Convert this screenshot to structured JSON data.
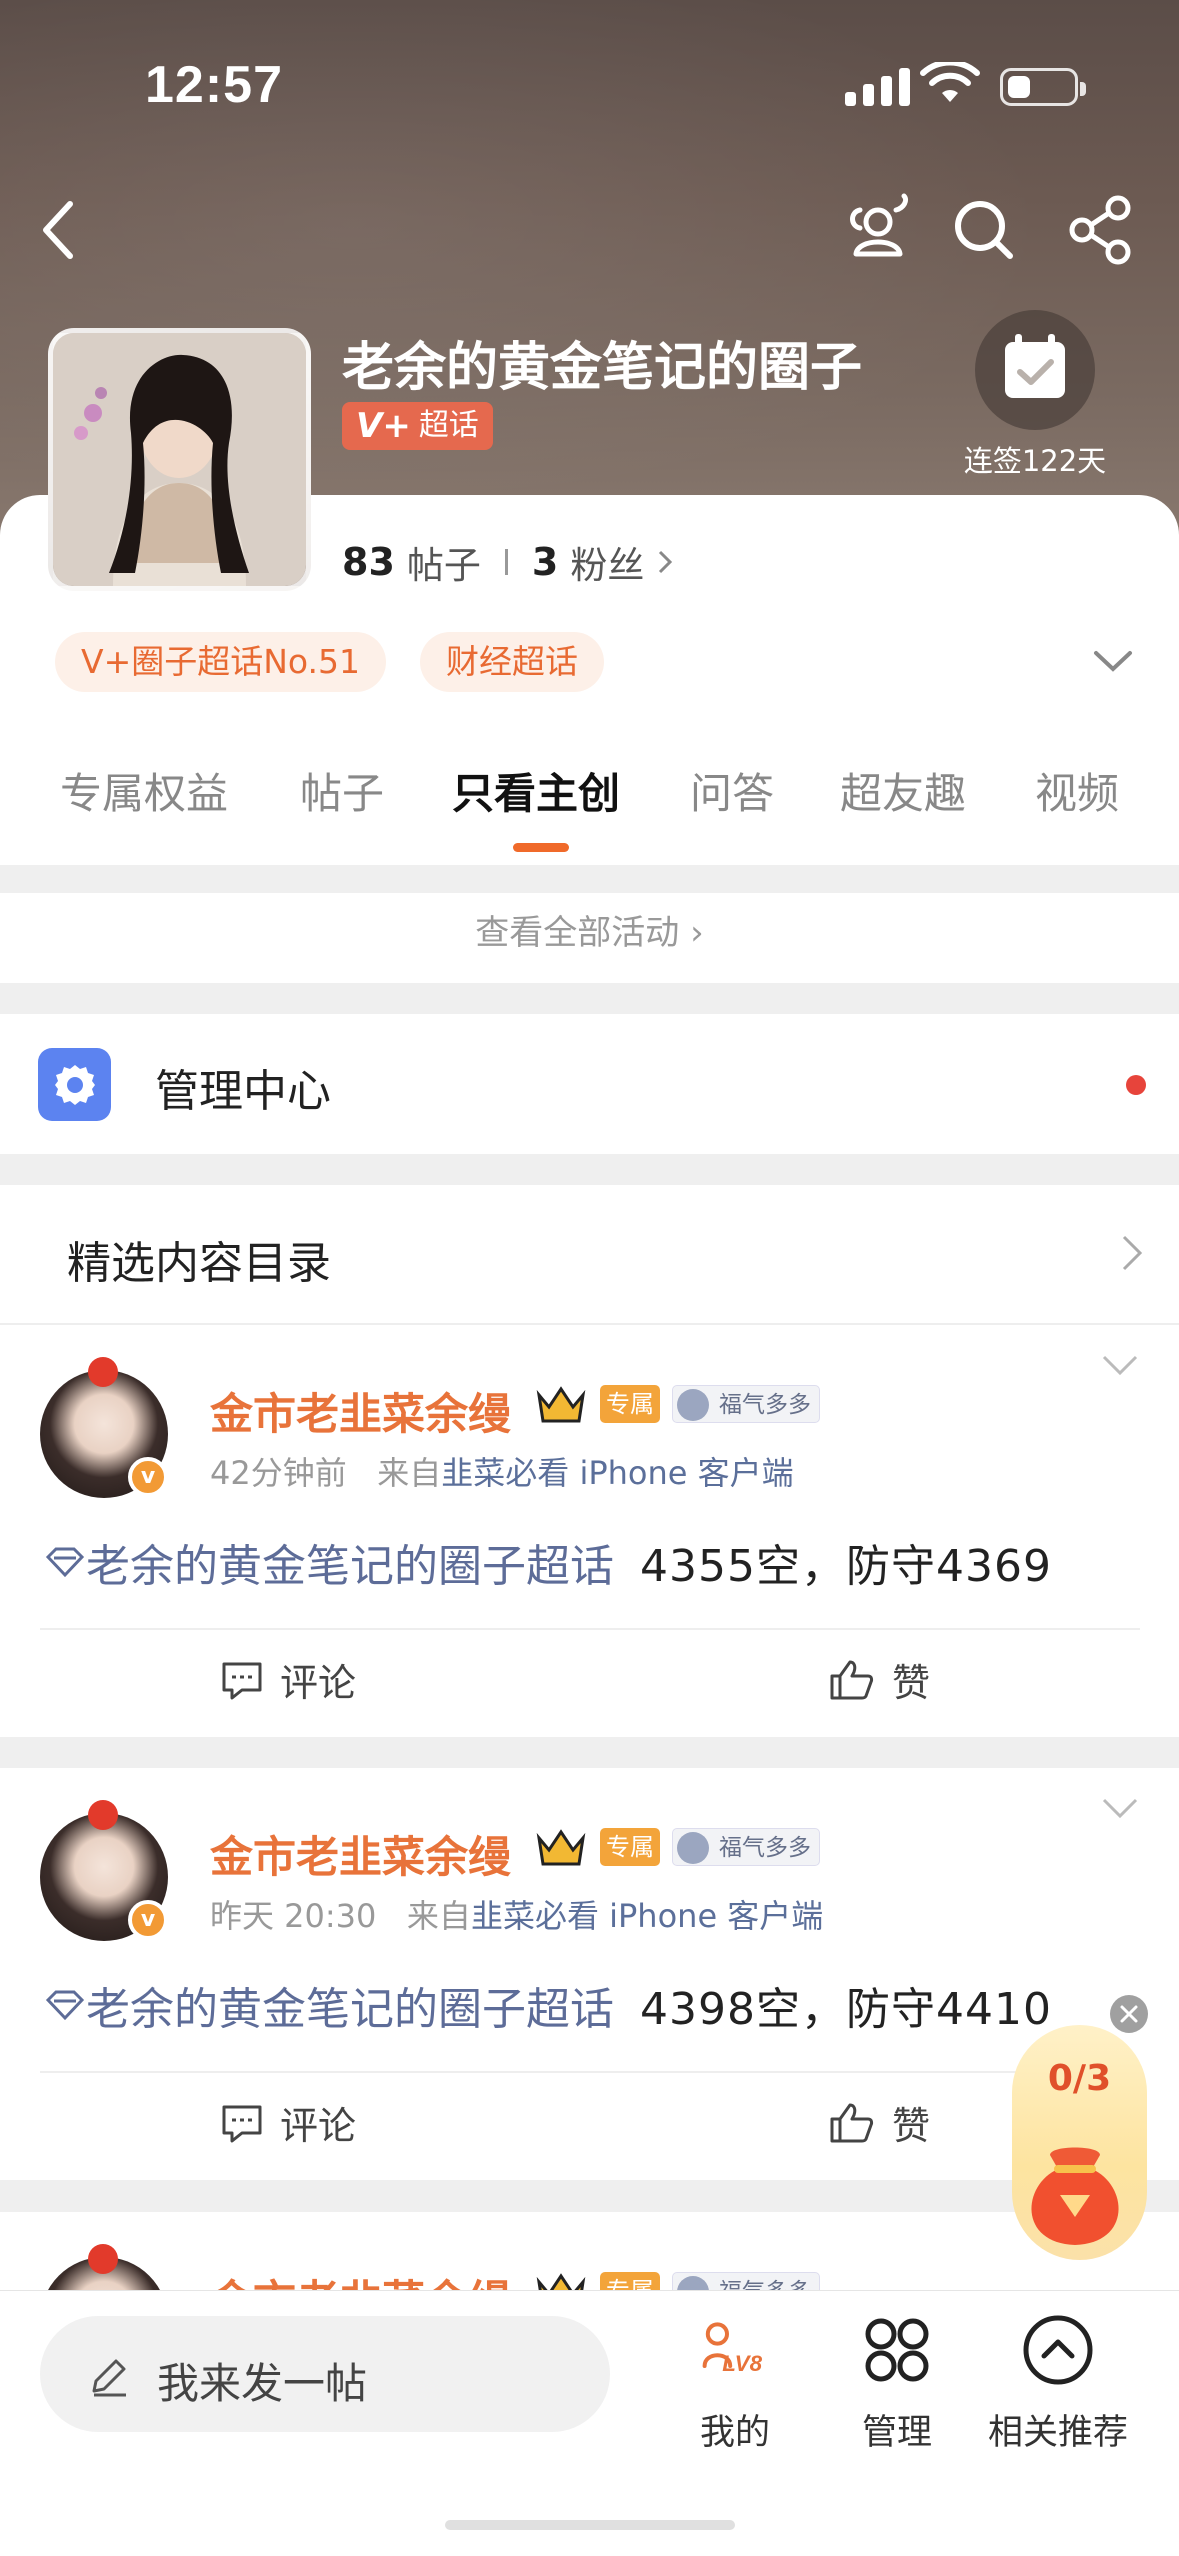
{
  "status_bar": {
    "time": "12:57"
  },
  "header": {
    "circle_title": "老余的黄金笔记的圈子",
    "tag_label": "超话",
    "checkin_label": "连签122天",
    "icons": [
      "back-arrow-icon",
      "chat-group-icon",
      "search-icon",
      "share-icon",
      "calendar-check-icon"
    ]
  },
  "stats": {
    "posts_count": "83",
    "posts_label": "帖子",
    "fans_count": "3",
    "fans_label": "粉丝"
  },
  "chips": [
    "V+圈子超话No.51",
    "财经超话"
  ],
  "tabs": [
    "专属权益",
    "帖子",
    "只看主创",
    "问答",
    "超友趣",
    "视频"
  ],
  "active_tab": "只看主创",
  "view_all_label": "查看全部活动",
  "management": {
    "label": "管理中心"
  },
  "catalog": {
    "label": "精选内容目录"
  },
  "posts": [
    {
      "author": "金市老韭菜余缦",
      "badge_exclusive": "专属",
      "badge_fortune": "福气多多",
      "time": "42分钟前",
      "source_prefix": "来自",
      "source": "韭菜必看 iPhone 客户端",
      "topic": "老余的黄金笔记的圈子超话",
      "text": "4355空，防守4369",
      "comment_label": "评论",
      "like_label": "赞"
    },
    {
      "author": "金市老韭菜余缦",
      "badge_exclusive": "专属",
      "badge_fortune": "福气多多",
      "time": "昨天 20:30",
      "source_prefix": "来自",
      "source": "韭菜必看 iPhone 客户端",
      "topic": "老余的黄金笔记的圈子超话",
      "text": "4398空，防守4410",
      "comment_label": "评论",
      "like_label": "赞"
    },
    {
      "author": "金市老韭菜余缦",
      "badge_exclusive": "专属",
      "badge_fortune": "福气多多"
    }
  ],
  "reward": {
    "count": "0/3"
  },
  "bottom_bar": {
    "compose_placeholder": "我来发一帖",
    "level_badge": "LV8",
    "items": [
      "我的",
      "管理",
      "相关推荐"
    ]
  },
  "colors": {
    "accent": "#f06a2a",
    "author": "#e8733a",
    "topic": "#5d6c98",
    "manage_icon": "#5c83f0"
  }
}
